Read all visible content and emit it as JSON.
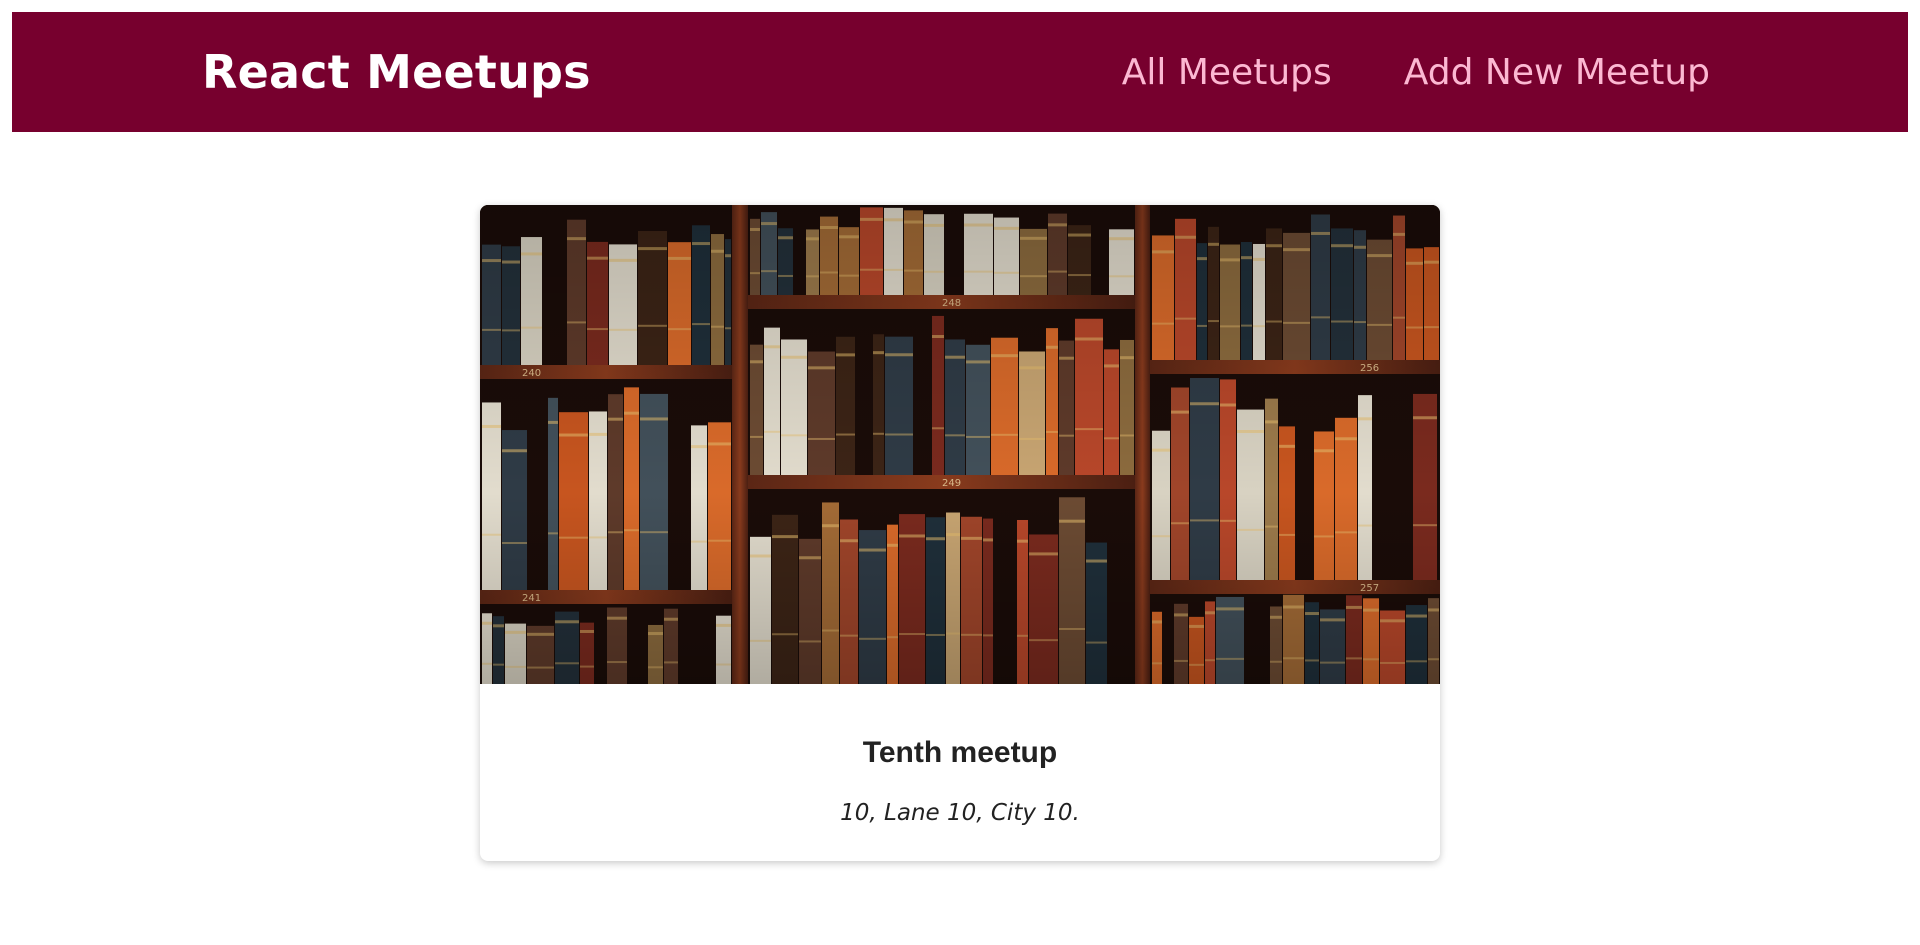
{
  "header": {
    "logo": "React Meetups",
    "nav": [
      {
        "label": "All Meetups"
      },
      {
        "label": "Add New Meetup"
      }
    ]
  },
  "meetup": {
    "title": "Tenth meetup",
    "address": "10, Lane 10, City 10.",
    "image": {
      "shelf_labels": [
        "240",
        "248",
        "256",
        "249",
        "241",
        "257"
      ]
    }
  },
  "colors": {
    "header_bg": "#77002e",
    "logo": "#ffffff",
    "nav_link": "#fcb8d2",
    "text": "#222222"
  }
}
